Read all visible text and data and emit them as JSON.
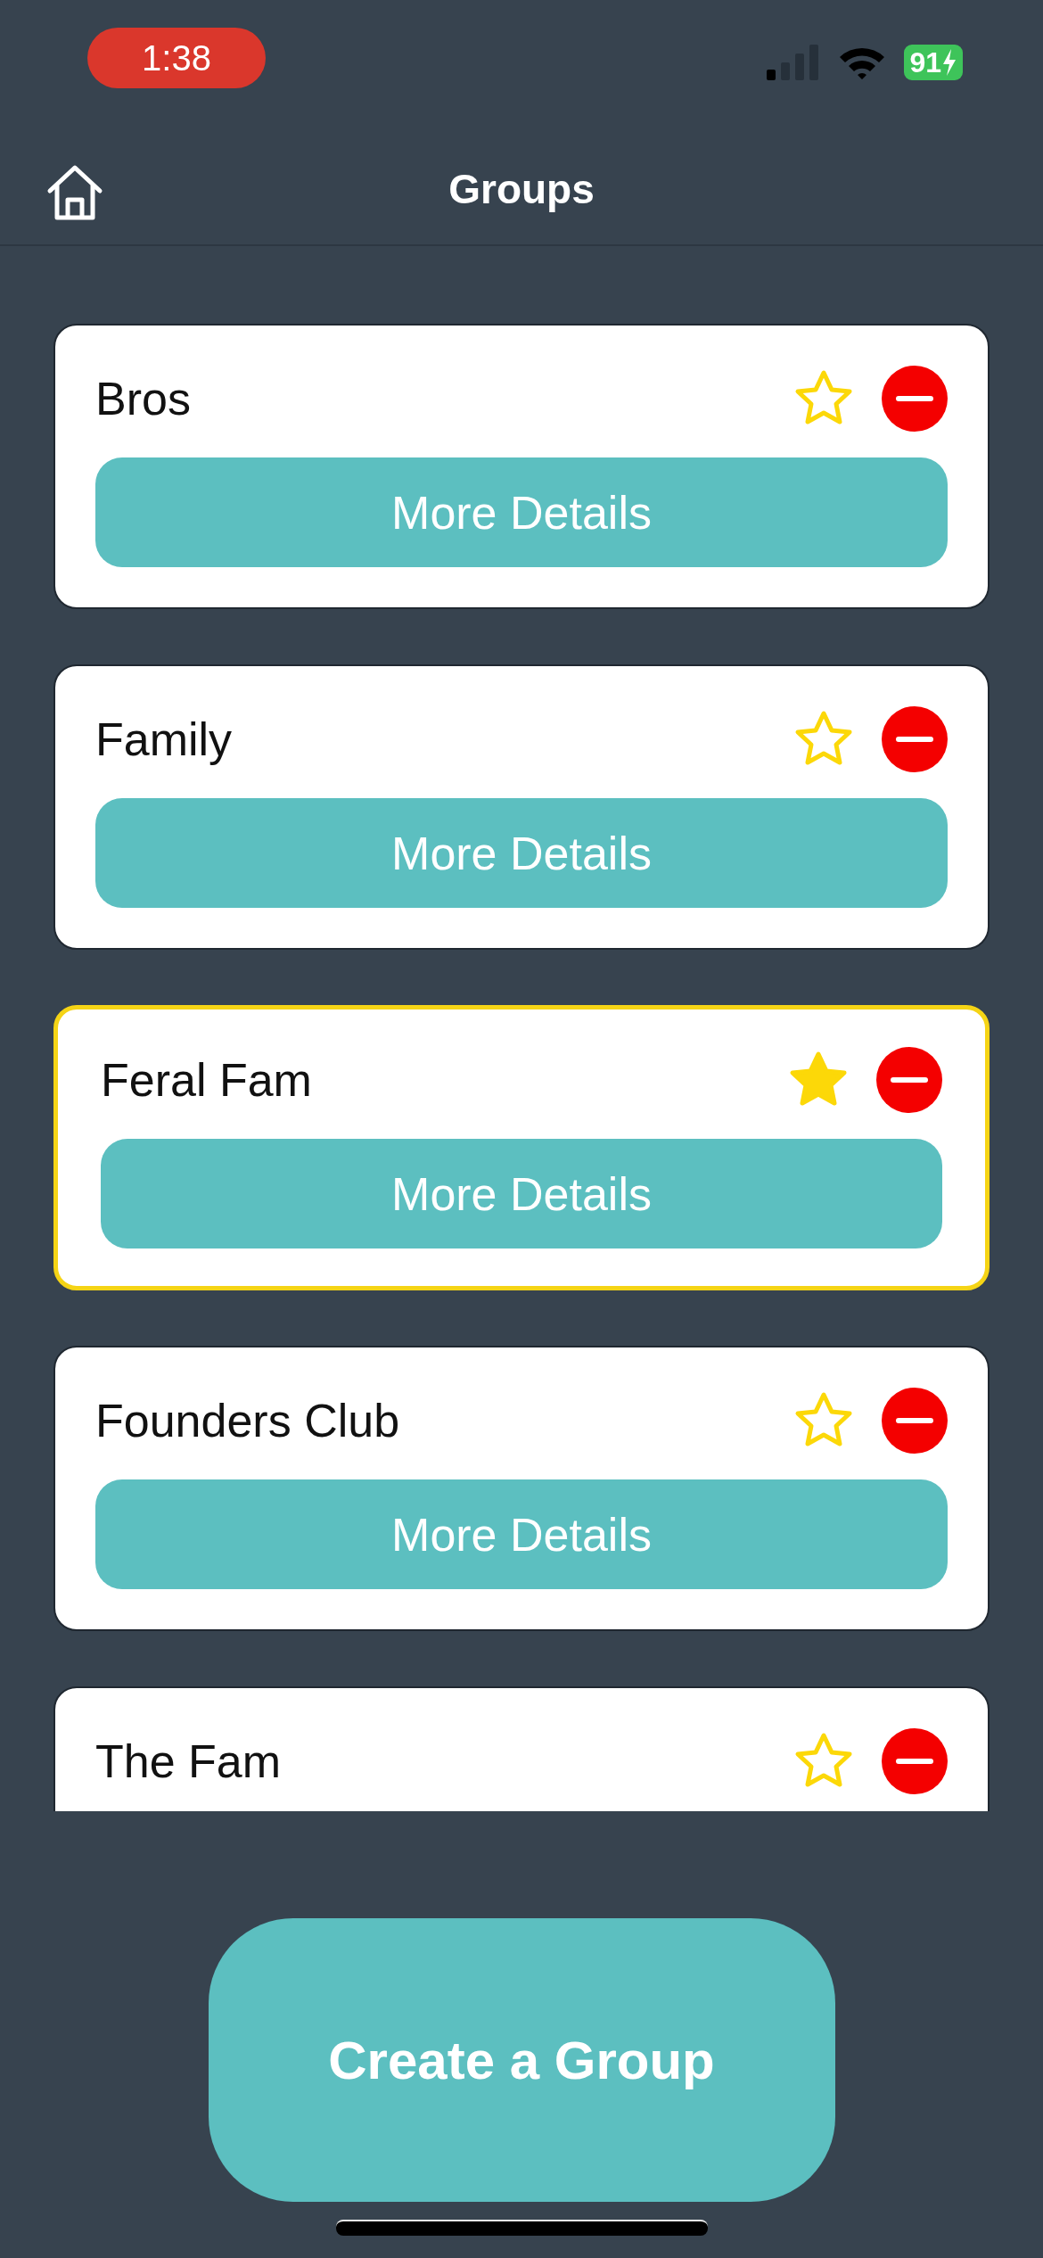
{
  "status_bar": {
    "time": "1:38",
    "battery": "91"
  },
  "header": {
    "title": "Groups"
  },
  "groups": [
    {
      "name": "Bros",
      "favorite": false,
      "button": "More Details"
    },
    {
      "name": "Family",
      "favorite": false,
      "button": "More Details"
    },
    {
      "name": "Feral Fam",
      "favorite": true,
      "button": "More Details"
    },
    {
      "name": "Founders Club",
      "favorite": false,
      "button": "More Details"
    },
    {
      "name": "The Fam",
      "favorite": false
    }
  ],
  "create_button": "Create a Group"
}
